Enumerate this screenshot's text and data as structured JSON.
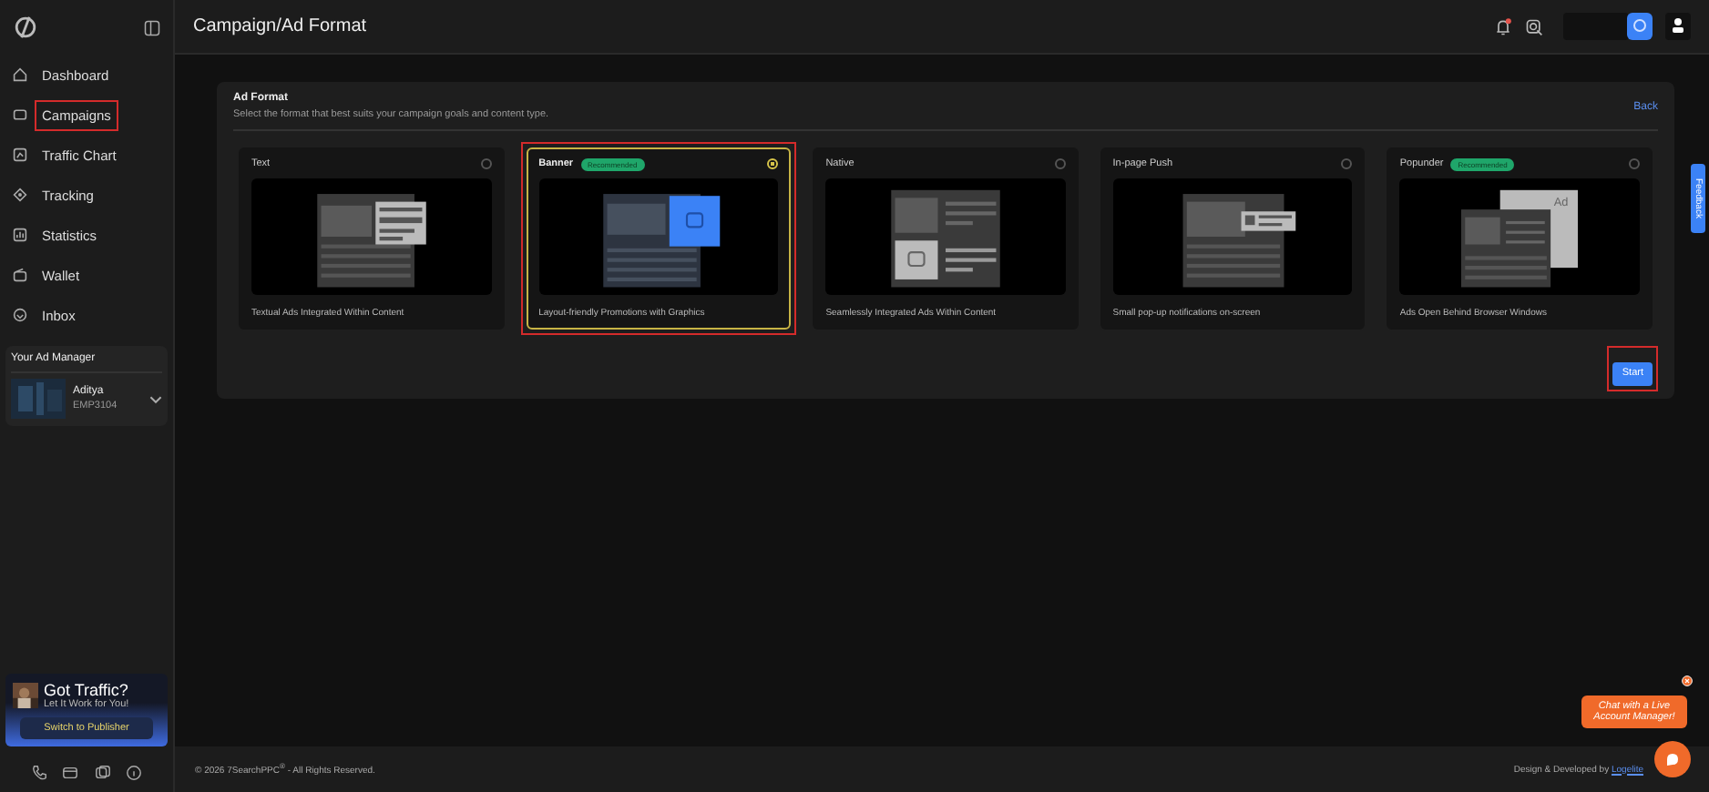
{
  "sidebar": {
    "items": [
      {
        "label": "Dashboard",
        "kind": "home",
        "selected": false
      },
      {
        "label": "Campaigns",
        "kind": "ad",
        "selected": true
      },
      {
        "label": "Traffic Chart",
        "kind": "chart",
        "selected": false
      },
      {
        "label": "Tracking",
        "kind": "target",
        "selected": false
      },
      {
        "label": "Statistics",
        "kind": "stats",
        "selected": false
      },
      {
        "label": "Wallet",
        "kind": "wallet",
        "selected": false
      },
      {
        "label": "Inbox",
        "kind": "inbox",
        "selected": false
      }
    ],
    "manager": {
      "heading": "Your Ad Manager",
      "name": "Aditya",
      "code": "EMP3104"
    },
    "promo": {
      "title": "Got Traffic?",
      "subtitle": "Let It Work for You!",
      "button": "Switch to Publisher"
    }
  },
  "header": {
    "title": "Campaign/Ad Format",
    "has_notification": true
  },
  "panel": {
    "title": "Ad Format",
    "subtitle": "Select the format that best suits your campaign goals and content type.",
    "back": "Back",
    "cards": [
      {
        "kind": "text",
        "title": "Text",
        "description": "Textual Ads Integrated Within Content",
        "selected": false
      },
      {
        "kind": "banner",
        "title": "Banner",
        "badge": "Recommended",
        "description": "Layout-friendly Promotions with Graphics",
        "selected": true
      },
      {
        "kind": "native",
        "title": "Native",
        "description": "Seamlessly Integrated Ads Within Content",
        "selected": false
      },
      {
        "kind": "push",
        "title": "In-page Push",
        "description": "Small pop-up notifications on-screen",
        "selected": false
      },
      {
        "kind": "popunder",
        "title": "Popunder",
        "badge": "Recommended",
        "description": "Ads Open Behind Browser Windows",
        "selected": false,
        "ad_label": "Ad"
      }
    ],
    "start": {
      "label": "Start",
      "highlighted": true
    }
  },
  "feedback": "Feedback",
  "chat": {
    "message": "Chat with a Live Account Manager!"
  },
  "footer": {
    "copyright": "© 2026 7SearchPPC",
    "mark": "®",
    "rights": " - All Rights Reserved.",
    "credit": "Design & Developed by",
    "link": "Logelite"
  }
}
